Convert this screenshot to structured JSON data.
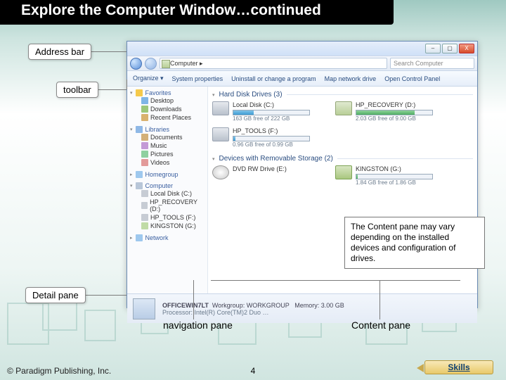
{
  "title": "Explore the Computer Window…continued",
  "callouts": {
    "address_bar": "Address bar",
    "toolbar": "toolbar",
    "detail_pane": "Detail pane",
    "navigation_pane": "navigation pane",
    "content_pane": "Content pane"
  },
  "note": "The Content pane may vary depending on the installed devices and configuration of drives.",
  "footer": "© Paradigm Publishing, Inc.",
  "page_number": "4",
  "skills_label": "Skills",
  "explorer": {
    "window_controls": {
      "min": "–",
      "max": "▢",
      "close": "X"
    },
    "address_path": "Computer  ▸",
    "search_placeholder": "Search Computer",
    "toolbar_items": [
      "Organize ▾",
      "System properties",
      "Uninstall or change a program",
      "Map network drive",
      "Open Control Panel"
    ],
    "nav": {
      "favorites": {
        "label": "Favorites",
        "items": [
          "Desktop",
          "Downloads",
          "Recent Places"
        ]
      },
      "libraries": {
        "label": "Libraries",
        "items": [
          "Documents",
          "Music",
          "Pictures",
          "Videos"
        ]
      },
      "homegroup": {
        "label": "Homegroup"
      },
      "computer": {
        "label": "Computer",
        "items": [
          "Local Disk (C:)",
          "HP_RECOVERY (D:)",
          "HP_TOOLS (F:)",
          "KINGSTON (G:)"
        ]
      },
      "network": {
        "label": "Network"
      }
    },
    "groups": {
      "hdd": {
        "label": "Hard Disk Drives (3)",
        "drives": [
          {
            "name": "Local Disk (C:)",
            "sub": "163 GB free of 222 GB"
          },
          {
            "name": "HP_RECOVERY (D:)",
            "sub": "2.03 GB free of 9.00 GB"
          },
          {
            "name": "HP_TOOLS (F:)",
            "sub": "0.96 GB free of 0.99 GB"
          }
        ]
      },
      "removable": {
        "label": "Devices with Removable Storage (2)",
        "drives": [
          {
            "name": "DVD RW Drive (E:)",
            "sub": ""
          },
          {
            "name": "KINGSTON (G:)",
            "sub": "1.84 GB free of 1.86 GB"
          }
        ]
      }
    },
    "details": {
      "name": "OFFICEWIN7LT",
      "workgroup_label": "Workgroup:",
      "workgroup": "WORKGROUP",
      "memory_label": "Memory:",
      "memory": "3.00 GB",
      "processor_label": "Processor:",
      "processor": "Intel(R) Core(TM)2 Duo …"
    }
  }
}
